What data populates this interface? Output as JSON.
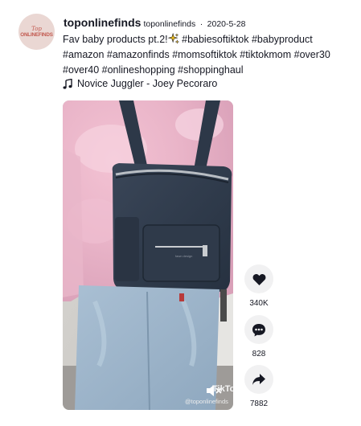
{
  "post": {
    "avatar": {
      "line1": "Top",
      "line2": "ONLINEFINDS"
    },
    "username": "toponlinefinds",
    "nickname": "toponlinefinds",
    "separator": "·",
    "date": "2020-5-28",
    "caption_text": "Fav baby products pt.2!",
    "hashtags_line1": "#babiesoftiktok #babyproduct",
    "hashtags_line2": "#amazon #amazonfinds #momsoftiktok #tiktokmom #over30",
    "hashtags_line3": "#over40 #onlineshopping #shoppinghaul",
    "music": "Novice Juggler - Joey Pecoraro"
  },
  "video": {
    "watermark_user": "@toponlinefinds",
    "watermark_logo": "TikTok",
    "muted": true
  },
  "actions": {
    "likes": "340K",
    "comments": "828",
    "shares": "7882"
  },
  "colors": {
    "text": "#161823",
    "button_bg": "#f1f1f2",
    "avatar_bg": "#ead7d3",
    "avatar_text": "#c2594f"
  }
}
